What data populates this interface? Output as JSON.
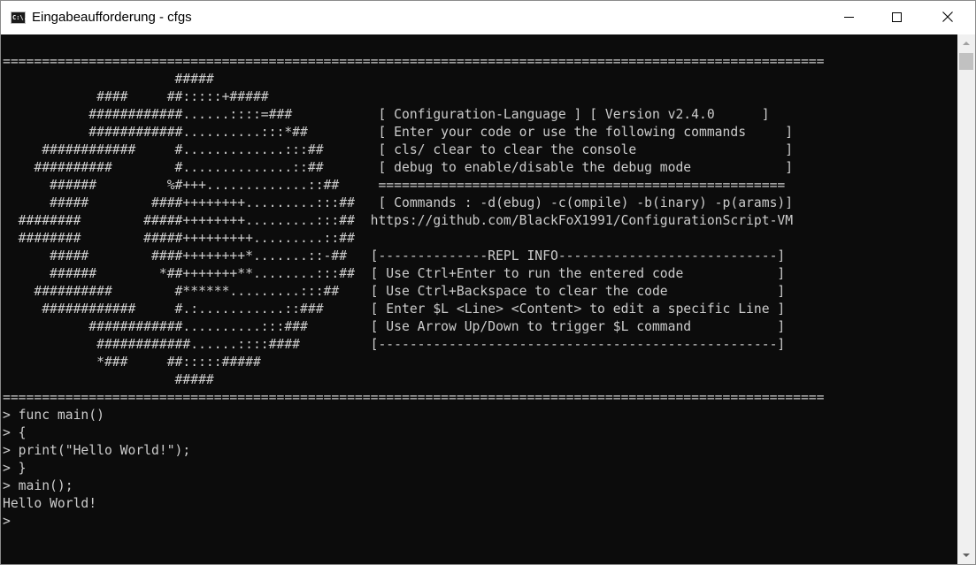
{
  "window": {
    "title": "Eingabeaufforderung - cfgs",
    "icon": "cmd-icon",
    "icon_glyph": "C:\\.",
    "controls": [
      "minimize-icon",
      "maximize-icon",
      "close-icon"
    ]
  },
  "colors": {
    "console_background": "#0c0c0c",
    "console_text": "#cccccc",
    "titlebar_background": "#ffffff"
  },
  "console": {
    "lines": [
      "=========================================================================================================",
      "                      #####",
      "            ####     ##:::::+#####",
      "           ############......::::=###           [ Configuration-Language ] [ Version v2.4.0      ]",
      "           ############..........:::*##         [ Enter your code or use the following commands     ]",
      "     ############     #.............:::##       [ cls/ clear to clear the console                   ]",
      "    ##########        #..............::##       [ debug to enable/disable the debug mode            ]",
      "      ######         %#+++.............::##     ====================================================",
      "      #####        ####++++++++.........:::##   [ Commands : -d(ebug) -c(ompile) -b(inary) -p(arams)]",
      "  ########        #####++++++++.........:::##  https://github.com/BlackFoX1991/ConfigurationScript-VM",
      "  ########        #####+++++++++.........::##",
      "      #####        ####++++++++*.......::-##   [--------------REPL INFO----------------------------]",
      "      ######        *##+++++++**........:::##  [ Use Ctrl+Enter to run the entered code            ]",
      "    ##########        #******.........:::##    [ Use Ctrl+Backspace to clear the code              ]",
      "     ############     #.:...........::###      [ Enter $L <Line> <Content> to edit a specific Line ]",
      "           ############..........:::###        [ Use Arrow Up/Down to trigger $L command           ]",
      "            ############......::::####         [---------------------------------------------------]",
      "            *###     ##:::::#####",
      "                      #####",
      "=========================================================================================================",
      "> func main()",
      "> {",
      "> print(\"Hello World!\");",
      "> }",
      "> main();",
      "Hello World!",
      ">"
    ]
  }
}
